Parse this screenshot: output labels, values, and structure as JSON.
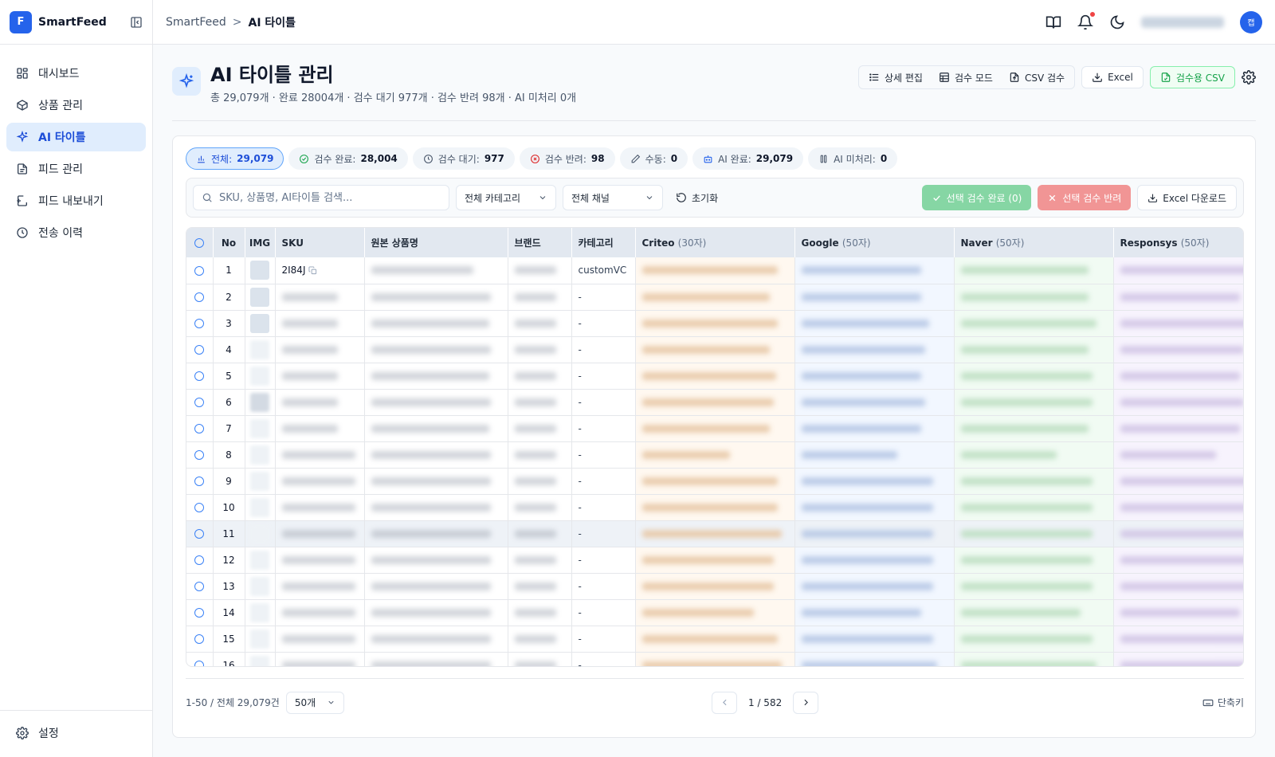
{
  "brand": {
    "logo_letter": "F",
    "name": "SmartFeed"
  },
  "nav": {
    "items": [
      {
        "label": "대시보드",
        "icon": "dashboard-icon"
      },
      {
        "label": "상품 관리",
        "icon": "box-icon"
      },
      {
        "label": "AI 타이틀",
        "icon": "sparkles-icon",
        "active": true
      },
      {
        "label": "피드 관리",
        "icon": "document-icon"
      },
      {
        "label": "피드 내보내기",
        "icon": "export-icon"
      },
      {
        "label": "전송 이력",
        "icon": "clock-icon"
      }
    ],
    "settings": "설정"
  },
  "breadcrumb": {
    "root": "SmartFeed",
    "separator": ">",
    "current": "AI 타이틀"
  },
  "topbar": {
    "avatar_initial": "캡",
    "has_notification": true
  },
  "page": {
    "title": "AI 타이틀 관리",
    "subtitle": "총 29,079개 · 완료 28004개 · 검수 대기 977개 · 검수 반려 98개 · AI 미처리 0개"
  },
  "actions": {
    "detail_edit": "상세 편집",
    "review_mode": "검수 모드",
    "csv_review": "CSV 검수",
    "excel": "Excel",
    "review_csv": "검수용 CSV"
  },
  "chips": [
    {
      "label": "전체:",
      "count": "29,079",
      "icon": "chart-icon",
      "active": true
    },
    {
      "label": "검수 완료:",
      "count": "28,004",
      "icon": "check-circle-icon"
    },
    {
      "label": "검수 대기:",
      "count": "977",
      "icon": "clock-icon"
    },
    {
      "label": "검수 반려:",
      "count": "98",
      "icon": "x-circle-icon"
    },
    {
      "label": "수동:",
      "count": "0",
      "icon": "pencil-icon"
    },
    {
      "label": "AI 완료:",
      "count": "29,079",
      "icon": "robot-icon"
    },
    {
      "label": "AI 미처리:",
      "count": "0",
      "icon": "pause-icon"
    }
  ],
  "toolbar": {
    "search_placeholder": "SKU, 상품명, AI타이틀 검색...",
    "category": "전체 카테고리",
    "channel": "전체 채널",
    "reset": "초기화",
    "approve": "선택 검수 완료 (0)",
    "reject": "선택 검수 반려",
    "excel_download": "Excel 다운로드"
  },
  "table": {
    "columns": {
      "no": "No",
      "img": "IMG",
      "sku": "SKU",
      "name": "원본 상품명",
      "brand": "브랜드",
      "category": "카테고리"
    },
    "channels": [
      {
        "name": "Criteo",
        "limit": "(30자)"
      },
      {
        "name": "Google",
        "limit": "(50자)"
      },
      {
        "name": "Naver",
        "limit": "(50자)"
      },
      {
        "name": "Responsys",
        "limit": "(50자)"
      }
    ],
    "rows": [
      {
        "no": "1",
        "sku": "2I84J",
        "category": "customVC"
      },
      {
        "no": "2",
        "category": "-"
      },
      {
        "no": "3",
        "category": "-"
      },
      {
        "no": "4",
        "category": "-"
      },
      {
        "no": "5",
        "category": "-"
      },
      {
        "no": "6",
        "category": "-"
      },
      {
        "no": "7",
        "category": "-"
      },
      {
        "no": "8",
        "category": "-"
      },
      {
        "no": "9",
        "category": "-"
      },
      {
        "no": "10",
        "category": "-"
      },
      {
        "no": "11",
        "category": "-",
        "highlight": true
      },
      {
        "no": "12",
        "category": "-"
      },
      {
        "no": "13",
        "category": "-"
      },
      {
        "no": "14",
        "category": "-"
      },
      {
        "no": "15",
        "category": "-"
      },
      {
        "no": "16",
        "category": "-"
      }
    ]
  },
  "pagination": {
    "info": "1-50 / 전체 29,079건",
    "page_size": "50개",
    "page": "1 / 582",
    "shortcut": "단축키"
  },
  "colors": {
    "accent": "#2563eb",
    "approve": "#86d6a4",
    "reject": "#f19595",
    "success": "#16a34a"
  }
}
